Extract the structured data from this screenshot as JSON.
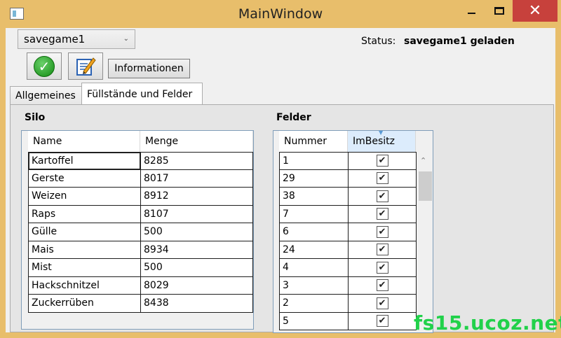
{
  "window": {
    "title": "MainWindow",
    "close_glyph": "✕"
  },
  "toolbar": {
    "savegame_selected": "savegame1",
    "info_button": "Informationen",
    "status_label": "Status:",
    "status_value": "savegame1 geladen"
  },
  "tabs": [
    {
      "label": "Allgemeines",
      "selected": false
    },
    {
      "label": "Füllstände und Felder",
      "selected": true
    }
  ],
  "silo": {
    "title": "Silo",
    "columns": [
      "Name",
      "Menge"
    ],
    "rows": [
      [
        "Kartoffel",
        "8285"
      ],
      [
        "Gerste",
        "8017"
      ],
      [
        "Weizen",
        "8912"
      ],
      [
        "Raps",
        "8107"
      ],
      [
        "Gülle",
        "500"
      ],
      [
        "Mais",
        "8934"
      ],
      [
        "Mist",
        "500"
      ],
      [
        "Hackschnitzel",
        "8029"
      ],
      [
        "Zuckerrüben",
        "8438"
      ]
    ]
  },
  "felder": {
    "title": "Felder",
    "columns": [
      "Nummer",
      "ImBesitz"
    ],
    "rows": [
      {
        "nummer": "1",
        "im_besitz": true
      },
      {
        "nummer": "29",
        "im_besitz": true
      },
      {
        "nummer": "38",
        "im_besitz": true
      },
      {
        "nummer": "7",
        "im_besitz": true
      },
      {
        "nummer": "6",
        "im_besitz": true
      },
      {
        "nummer": "24",
        "im_besitz": true
      },
      {
        "nummer": "4",
        "im_besitz": true
      },
      {
        "nummer": "3",
        "im_besitz": true
      },
      {
        "nummer": "2",
        "im_besitz": true
      },
      {
        "nummer": "5",
        "im_besitz": true
      }
    ]
  },
  "watermark": "fs15.ucoz.net",
  "colors": {
    "titlebar": "#e8be6b",
    "close_button": "#c7413c",
    "watermark": "#21d14a"
  }
}
